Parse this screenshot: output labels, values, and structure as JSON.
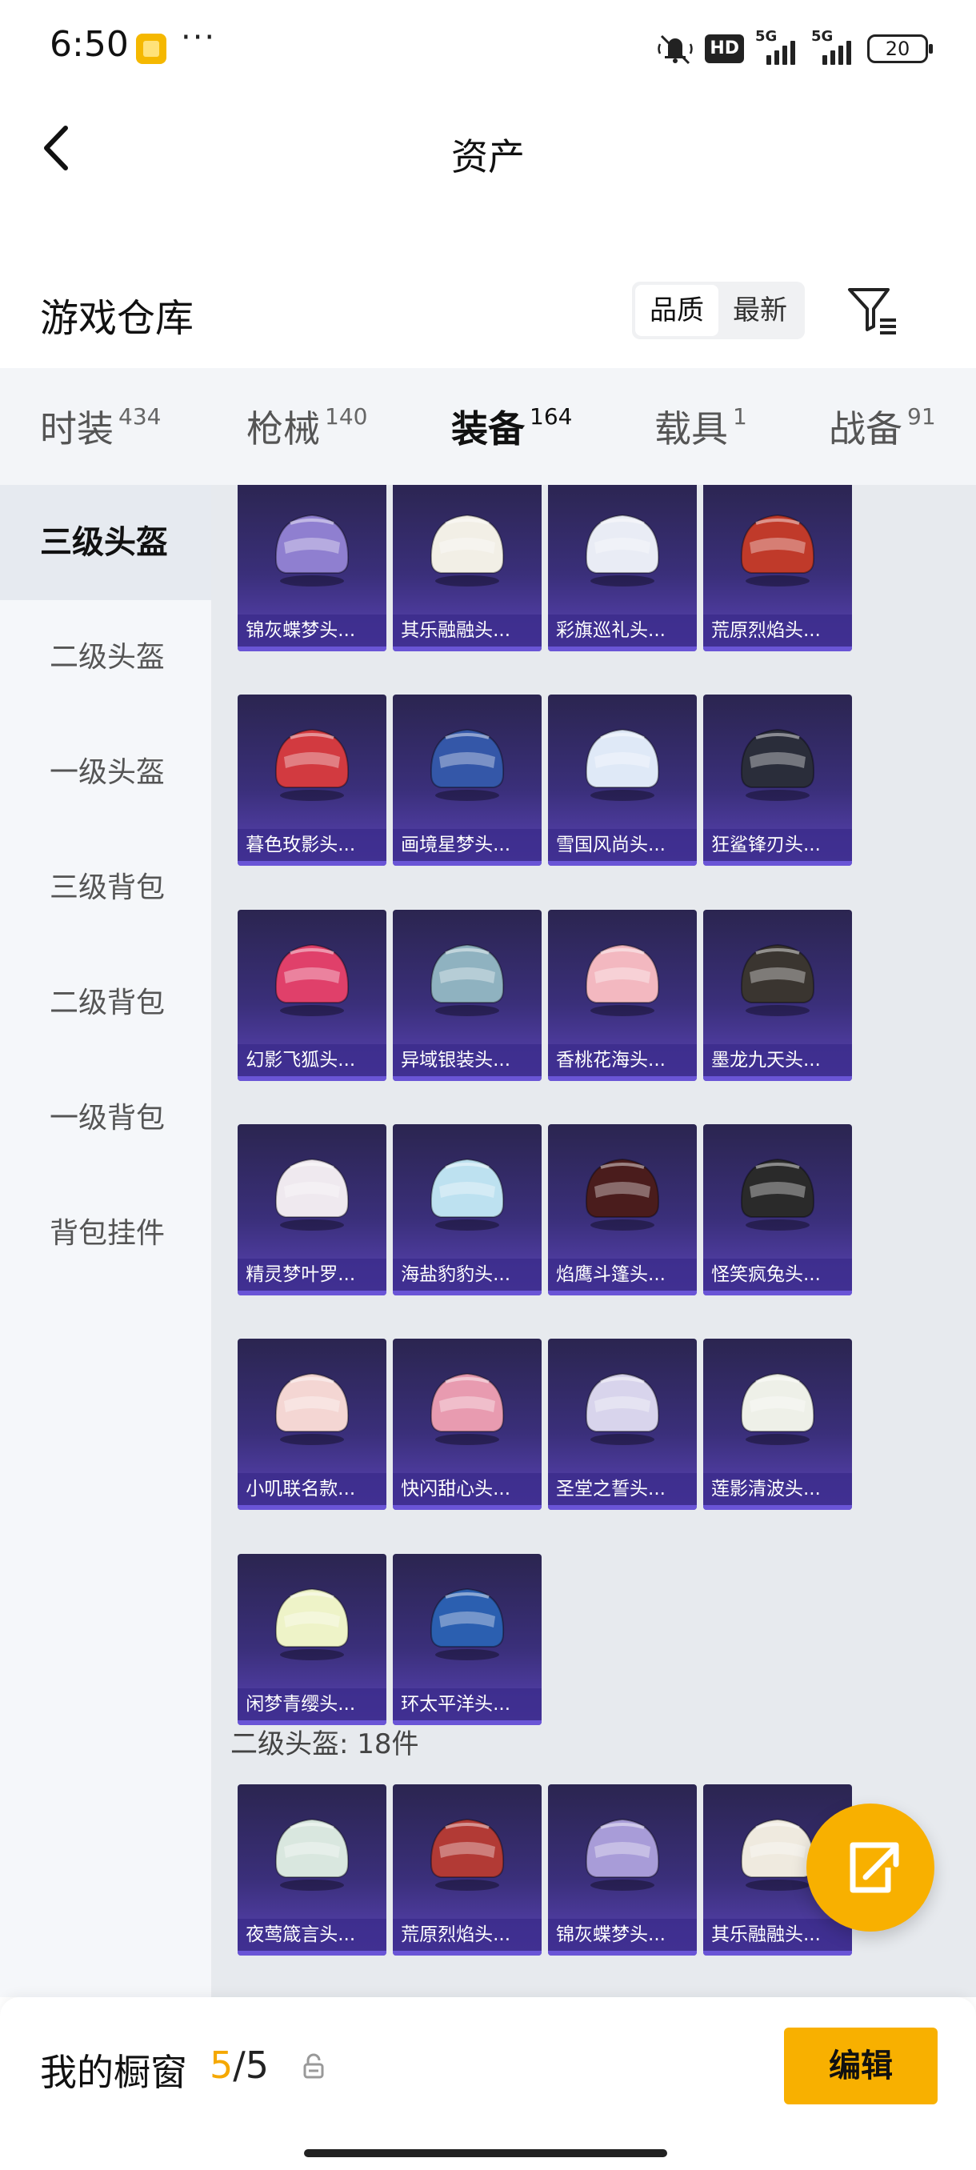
{
  "status_bar": {
    "time": "6:50",
    "dots": "···",
    "hd_label": "HD",
    "signal1_label": "5G",
    "signal2_label": "5G",
    "battery": "20"
  },
  "header": {
    "title": "资产"
  },
  "warehouse": {
    "title": "游戏仓库",
    "sort_options": [
      "品质",
      "最新"
    ],
    "sort_active_index": 0
  },
  "tabs": [
    {
      "name": "时装",
      "count": "434"
    },
    {
      "name": "枪械",
      "count": "140"
    },
    {
      "name": "装备",
      "count": "164"
    },
    {
      "name": "载具",
      "count": "1"
    },
    {
      "name": "战备",
      "count": "91"
    }
  ],
  "active_tab_index": 2,
  "sidebar": {
    "items": [
      "三级头盔",
      "二级头盔",
      "一级头盔",
      "三级背包",
      "二级背包",
      "一级背包",
      "背包挂件"
    ],
    "active_index": 0
  },
  "items_level3": [
    {
      "name": "锦灰蝶梦头...",
      "color": "#8f7fd0"
    },
    {
      "name": "其乐融融头...",
      "color": "#f2efe6"
    },
    {
      "name": "彩旗巡礼头...",
      "color": "#e9ecf5"
    },
    {
      "name": "荒原烈焰头...",
      "color": "#c03a2a"
    },
    {
      "name": "暮色玫影头...",
      "color": "#d23a40"
    },
    {
      "name": "画境星梦头...",
      "color": "#3457a8"
    },
    {
      "name": "雪国风尚头...",
      "color": "#dfe9f7"
    },
    {
      "name": "狂鲨锋刃头...",
      "color": "#2a2d3a"
    },
    {
      "name": "幻影飞狐头...",
      "color": "#e0406a"
    },
    {
      "name": "异域银装头...",
      "color": "#8fb2c0"
    },
    {
      "name": "香桃花海头...",
      "color": "#f3b8c0"
    },
    {
      "name": "墨龙九天头...",
      "color": "#3a3530"
    },
    {
      "name": "精灵梦叶罗...",
      "color": "#efe9ef"
    },
    {
      "name": "海盐豹豹头...",
      "color": "#bde1f0"
    },
    {
      "name": "焰鹰斗篷头...",
      "color": "#4a1c1c"
    },
    {
      "name": "怪笑疯兔头...",
      "color": "#2a2a2a"
    },
    {
      "name": "小叽联名款...",
      "color": "#f4d6d3"
    },
    {
      "name": "快闪甜心头...",
      "color": "#e89bb0"
    },
    {
      "name": "圣堂之誓头...",
      "color": "#d8d4ec"
    },
    {
      "name": "莲影清波头...",
      "color": "#eef0e8"
    },
    {
      "name": "闲梦青缨头...",
      "color": "#eef3c8"
    },
    {
      "name": "环太平洋头...",
      "color": "#2b5fb0"
    }
  ],
  "section_level2": {
    "heading": "二级头盔: 18件"
  },
  "items_level2": [
    {
      "name": "夜莺箴言头...",
      "color": "#d9e7df"
    },
    {
      "name": "荒原烈焰头...",
      "color": "#b23a35"
    },
    {
      "name": "锦灰蝶梦头...",
      "color": "#a89cd8"
    },
    {
      "name": "其乐融融头...",
      "color": "#efeadf"
    }
  ],
  "bottom_bar": {
    "label": "我的橱窗",
    "current": "5",
    "separator": "/",
    "total": "5",
    "edit_label": "编辑"
  }
}
